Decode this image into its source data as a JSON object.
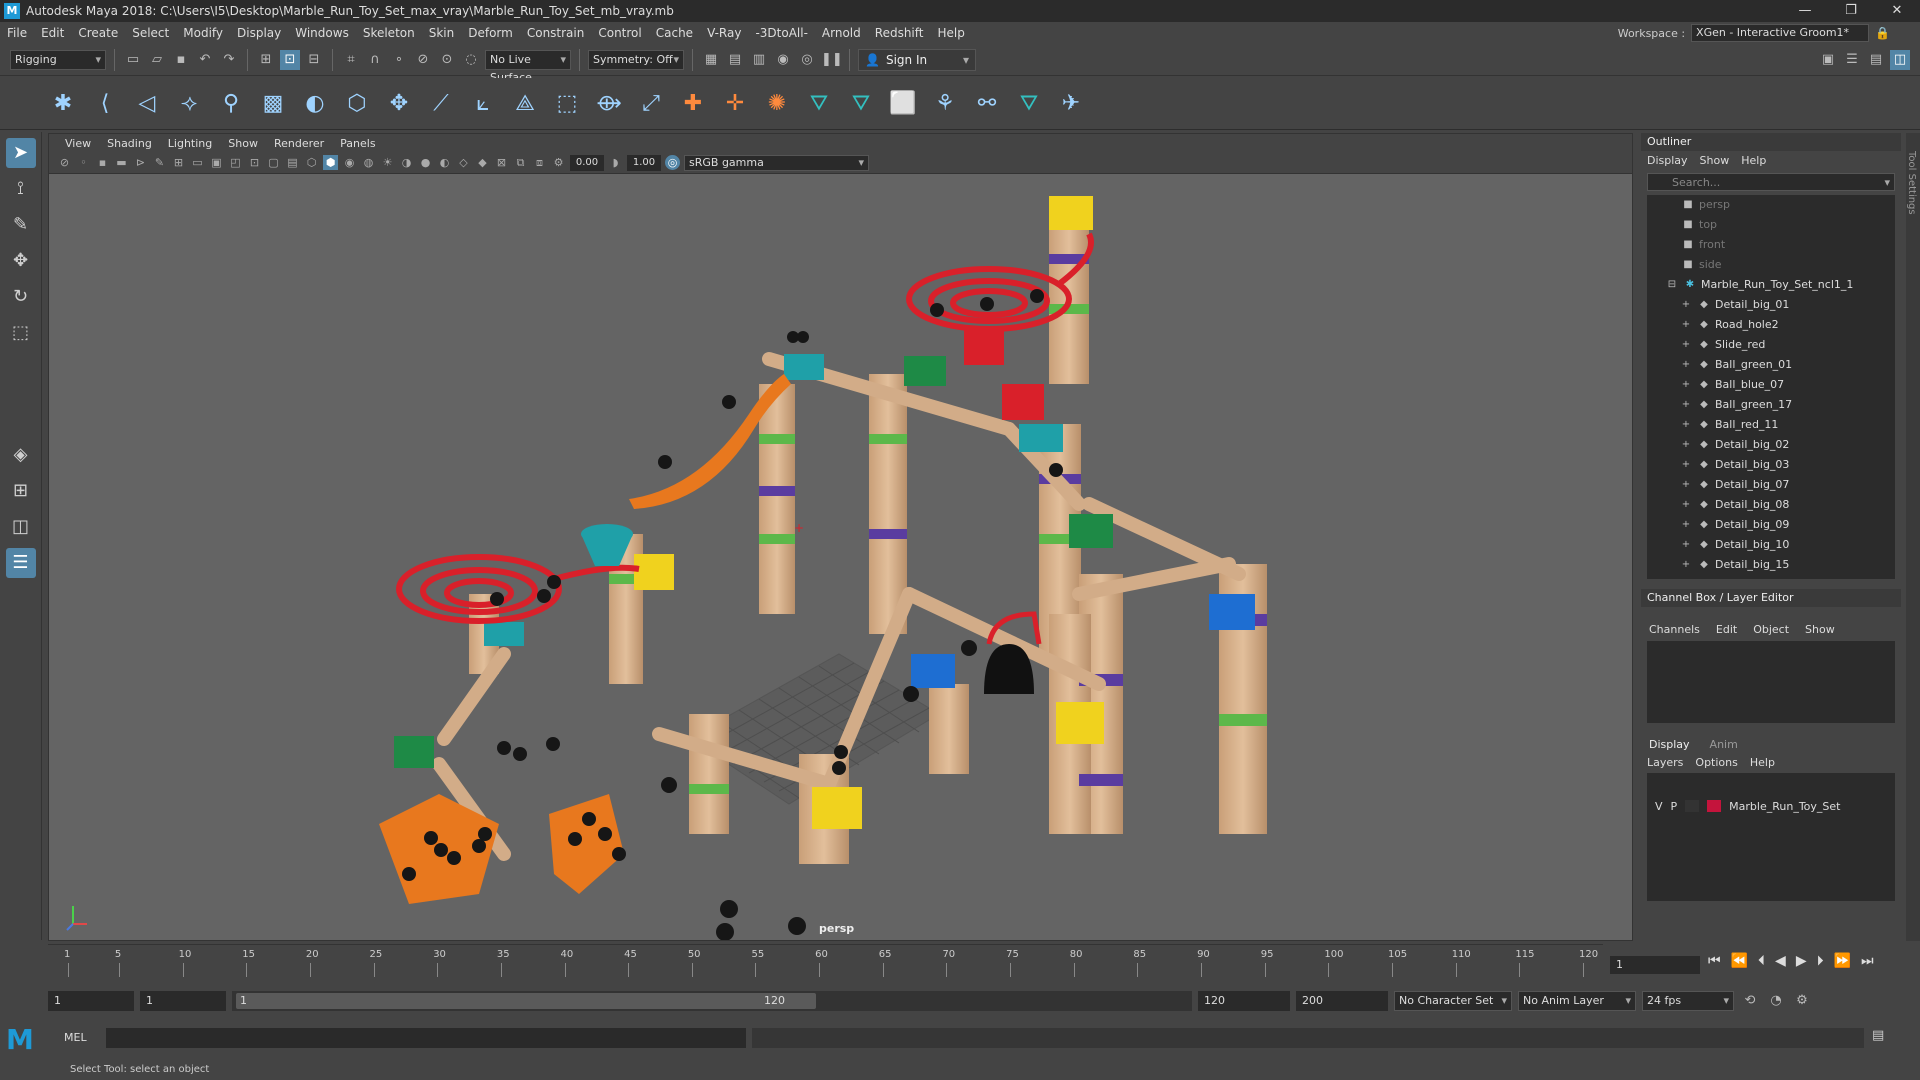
{
  "titlebar": {
    "title": "Autodesk Maya 2018: C:\\Users\\I5\\Desktop\\Marble_Run_Toy_Set_max_vray\\Marble_Run_Toy_Set_mb_vray.mb",
    "logo": "M",
    "minimize": "—",
    "maximize": "❐",
    "close": "✕"
  },
  "menubar": {
    "items": [
      "File",
      "Edit",
      "Create",
      "Select",
      "Modify",
      "Display",
      "Windows",
      "Skeleton",
      "Skin",
      "Deform",
      "Constrain",
      "Control",
      "Cache",
      "V-Ray",
      "-3DtoAll-",
      "Arnold",
      "Redshift",
      "Help"
    ],
    "workspace_label": "Workspace :",
    "workspace_value": "XGen - Interactive Groom1*"
  },
  "statusline": {
    "menuset": "Rigging",
    "live_surface": "No Live Surface",
    "symmetry": "Symmetry: Off",
    "sign_in": "Sign In"
  },
  "viewport": {
    "menus": [
      "View",
      "Shading",
      "Lighting",
      "Show",
      "Renderer",
      "Panels"
    ],
    "exposure": "0.00",
    "gamma": "1.00",
    "colorspace": "sRGB gamma",
    "camera": "persp"
  },
  "outliner": {
    "title": "Outliner",
    "menus": [
      "Display",
      "Show",
      "Help"
    ],
    "search_placeholder": "Search...",
    "cameras": [
      "persp",
      "top",
      "front",
      "side"
    ],
    "group": "Marble_Run_Toy_Set_ncl1_1",
    "items": [
      "Detail_big_01",
      "Road_hole2",
      "Slide_red",
      "Ball_green_01",
      "Ball_blue_07",
      "Ball_green_17",
      "Ball_red_11",
      "Detail_big_02",
      "Detail_big_03",
      "Detail_big_07",
      "Detail_big_08",
      "Detail_big_09",
      "Detail_big_10",
      "Detail_big_15"
    ]
  },
  "channelbox": {
    "title": "Channel Box / Layer Editor",
    "menus": [
      "Channels",
      "Edit",
      "Object",
      "Show"
    ]
  },
  "layers": {
    "tabs": [
      "Display",
      "Anim"
    ],
    "menus": [
      "Layers",
      "Options",
      "Help"
    ],
    "layer": {
      "v": "V",
      "p": "P",
      "name": "Marble_Run_Toy_Set",
      "color": "#c4143c"
    }
  },
  "toolsettings_label": "Tool Settings",
  "timeslider": {
    "labels": [
      "1",
      "5",
      "10",
      "15",
      "20",
      "25",
      "30",
      "35",
      "40",
      "45",
      "50",
      "55",
      "60",
      "65",
      "70",
      "75",
      "80",
      "85",
      "90",
      "95",
      "100",
      "105",
      "110",
      "115",
      "120"
    ],
    "current_frame": "1"
  },
  "rangebar": {
    "start": "1",
    "playback_start": "1",
    "slider_start": "1",
    "slider_end": "120",
    "playback_end": "120",
    "end": "200",
    "character_set": "No Character Set",
    "anim_layer": "No Anim Layer",
    "fps": "24 fps"
  },
  "cmdline": {
    "mel": "MEL",
    "help": "Select Tool: select an object"
  },
  "colors": {
    "accent": "#5285a6",
    "wood": "#d9b48f",
    "red": "#d9202a",
    "orange": "#e8781e",
    "teal": "#1fa0a8",
    "yellow": "#f0d21e",
    "green": "#1e8a46",
    "blue": "#1e6ed2",
    "purple": "#5a3ca0"
  }
}
